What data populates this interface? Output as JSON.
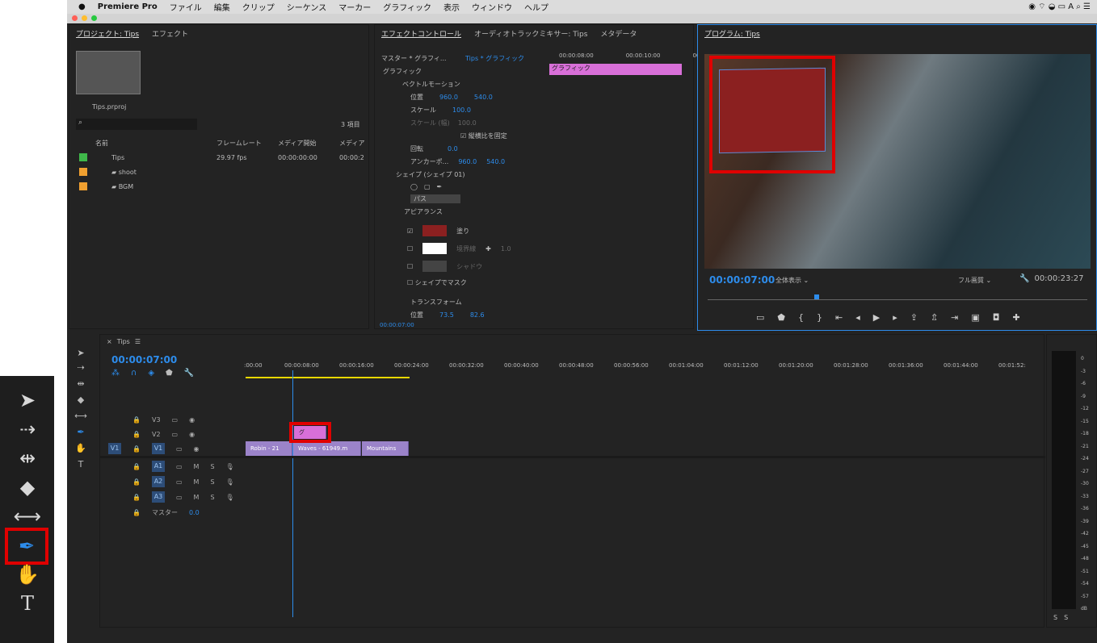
{
  "menubar": {
    "app": "Premiere Pro",
    "items": [
      "ファイル",
      "編集",
      "クリップ",
      "シーケンス",
      "マーカー",
      "グラフィック",
      "表示",
      "ウィンドウ",
      "ヘルプ"
    ]
  },
  "project": {
    "tabs": [
      "プロジェクト: Tips",
      "エフェクト"
    ],
    "file": "Tips.prproj",
    "count": "3 項目",
    "columns": [
      "名前",
      "フレームレート",
      "メディア開始",
      "メディア"
    ],
    "rows": [
      {
        "name": "Tips",
        "fps": "29.97 fps",
        "start": "00:00:00:00",
        "media": "00:00:2",
        "color": "#3fb84a"
      },
      {
        "name": "shoot",
        "fps": "",
        "start": "",
        "media": "",
        "color": "#f0a030"
      },
      {
        "name": "BGM",
        "fps": "",
        "start": "",
        "media": "",
        "color": "#f0a030"
      }
    ]
  },
  "effects": {
    "tabs": [
      "エフェクトコントロール",
      "オーディオトラックミキサー: Tips",
      "メタデータ"
    ],
    "master": "マスター * グラフィ...",
    "source": "Tips * グラフィック",
    "ruler": [
      "00:00:08:00",
      "00:00:10:00",
      "00:00"
    ],
    "clip_label": "グラフィック",
    "section": "グラフィック",
    "vector_motion": "ベクトルモーション",
    "position_label": "位置",
    "pos_x": "960.0",
    "pos_y": "540.0",
    "scale_label": "スケール",
    "scale": "100.0",
    "scale_w_label": "スケール (幅)",
    "scale_w": "100.0",
    "uniform": "縦横比を固定",
    "rotation_label": "回転",
    "rotation": "0.0",
    "anchor_label": "アンカーポ...",
    "anchor_x": "960.0",
    "anchor_y": "540.0",
    "shape_label": "シェイプ (シェイプ 01)",
    "path_label": "パス",
    "appearance": "アピアランス",
    "fill": "塗り",
    "fill_color": "#8b2020",
    "stroke": "境界線",
    "stroke_value": "1.0",
    "shadow": "シャドウ",
    "mask": "シェイプでマスク",
    "transform": "トランスフォーム",
    "t_pos_label": "位置",
    "t_pos_x": "73.5",
    "t_pos_y": "82.6",
    "timecode": "00:00:07:00"
  },
  "program": {
    "title": "プログラム: Tips",
    "timecode": "00:00:07:00",
    "fit": "全体表示",
    "quality": "フル画質",
    "duration": "00:00:23:27"
  },
  "timeline": {
    "tab": "Tips",
    "timecode": "00:00:07:00",
    "ruler": [
      ":00:00",
      "00:00:08:00",
      "00:00:16:00",
      "00:00:24:00",
      "00:00:32:00",
      "00:00:40:00",
      "00:00:48:00",
      "00:00:56:00",
      "00:01:04:00",
      "00:01:12:00",
      "00:01:20:00",
      "00:01:28:00",
      "00:01:36:00",
      "00:01:44:00",
      "00:01:52:"
    ],
    "tracks": {
      "v3": "V3",
      "v2": "V2",
      "v1": "V1",
      "src_v1": "V1",
      "a1": "A1",
      "a2": "A2",
      "a3": "A3",
      "master": "マスター",
      "master_val": "0.0",
      "m": "M",
      "s": "S"
    },
    "clips": [
      "Robin - 21",
      "Waves - 61949.m",
      "Mountains"
    ],
    "graphic_clip": "グ"
  },
  "meter": {
    "scale": [
      "0",
      "-3",
      "-6",
      "-9",
      "-12",
      "-15",
      "-18",
      "-21",
      "-24",
      "-27",
      "-30",
      "-33",
      "-36",
      "-39",
      "-42",
      "-45",
      "-48",
      "-51",
      "-54",
      "-57",
      "dB"
    ],
    "solo": [
      "S",
      "S"
    ]
  },
  "accent": "#2d8ceb",
  "highlight": "#e00000"
}
